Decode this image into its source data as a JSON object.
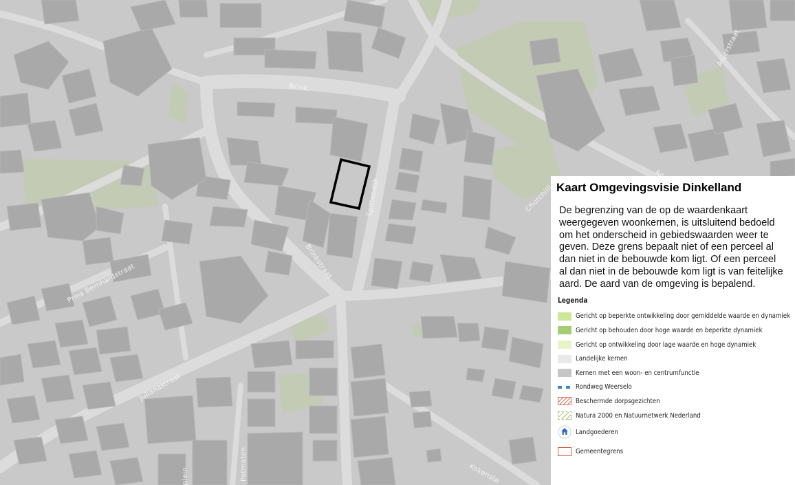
{
  "map": {
    "streets": [
      {
        "key": "brink",
        "name": "Brink"
      },
      {
        "key": "spittendijk",
        "name": "Spittendijk"
      },
      {
        "key": "brinkstraat",
        "name": "Brinkstraat"
      },
      {
        "key": "prins_bernhard",
        "name": "Prins Bernhardstraat"
      },
      {
        "key": "juliana",
        "name": "Julianastraat"
      },
      {
        "key": "churchill",
        "name": "Churchilll"
      },
      {
        "key": "anjer",
        "name": "Anjerstraat"
      },
      {
        "key": "an",
        "name": "An"
      },
      {
        "key": "kokenste",
        "name": "Kokenste"
      },
      {
        "key": "potmaten",
        "name": "Potmaten"
      },
      {
        "key": "plein",
        "name": "plein"
      }
    ],
    "colors": {
      "background": "#c9c9c9",
      "road": "#dcdcdc",
      "building": "#a9a9a9",
      "green": "#c4cbb4",
      "selection": "#000000"
    }
  },
  "panel": {
    "title": "Kaart Omgevingsvisie Dinkelland",
    "description": "De begrenzing van de op de waardenkaart weergegeven woonkernen, is uitsluitend bedoeld om het onderscheid in gebiedswaarden weer te geven. Deze grens bepaalt niet of een perceel al dan niet in de bebouwde kom ligt. Of een perceel al dan niet in de bebouwde kom ligt is van feitelijke aard. De aard van de omgeving is bepalend.",
    "legend_title": "Legenda",
    "legend": [
      {
        "label": "Gericht op beperkte ontwikkeling door gemiddelde waarde en dynamiek",
        "color": "#cde89a",
        "style": "fill"
      },
      {
        "label": "Gericht op behouden door hoge waarde en beperkte dynamiek",
        "color": "#a6cd74",
        "style": "fill"
      },
      {
        "label": "Gericht op ontwikkeling door lage waarde en hoge dynamiek",
        "color": "#e7f5c6",
        "style": "fill"
      },
      {
        "label": "Landelijke kernen",
        "color": "#e9e9e9",
        "style": "fill"
      },
      {
        "label": "Kernen met een woon- en centrumfunctie",
        "color": "#c6c6c6",
        "style": "fill"
      },
      {
        "label": "Rondweg Weerselo",
        "color": "#3a86d6",
        "style": "dash"
      },
      {
        "label": "Beschermde dorpsgezichten",
        "color": "#e07060",
        "style": "hatch"
      },
      {
        "label": "Natura 2000 en Natuurnetwerk Nederland",
        "color": "#9fbf6a",
        "style": "hatch-green"
      },
      {
        "label": "Landgoederen",
        "color": "#2a6fc4",
        "style": "icon"
      },
      {
        "label": "Gemeentegrens",
        "color": "#e05a3a",
        "style": "outline"
      }
    ]
  }
}
